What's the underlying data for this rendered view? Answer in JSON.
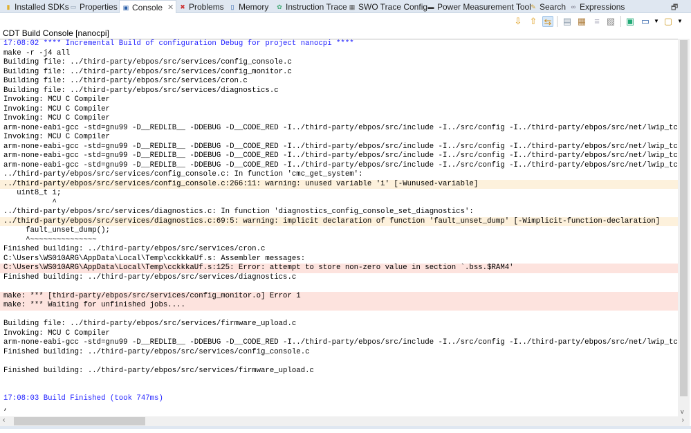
{
  "tabs": [
    {
      "label": "Installed SDKs",
      "icon": "sdk-icon"
    },
    {
      "label": "Properties",
      "icon": "properties-icon"
    },
    {
      "label": "Console",
      "icon": "console-icon",
      "active": true
    },
    {
      "label": "Problems",
      "icon": "problems-icon"
    },
    {
      "label": "Memory",
      "icon": "memory-icon"
    },
    {
      "label": "Instruction Trace",
      "icon": "instruction-trace-icon"
    },
    {
      "label": "SWO Trace Config",
      "icon": "swo-icon"
    },
    {
      "label": "Power Measurement Tool",
      "icon": "power-icon"
    },
    {
      "label": "Search",
      "icon": "search-icon"
    },
    {
      "label": "Expressions",
      "icon": "expressions-icon"
    }
  ],
  "console_title": "CDT Build Console [nanocpi]",
  "colors": {
    "info": "#1f1fff",
    "warning_bg": "#fdf1dc",
    "error_bg": "#fde3de"
  },
  "lines": [
    {
      "t": "17:08:02 **** Incremental Build of configuration Debug for project nanocpi ****",
      "k": "info"
    },
    {
      "t": "make -r -j4 all"
    },
    {
      "t": "Building file: ../third-party/ebpos/src/services/config_console.c"
    },
    {
      "t": "Building file: ../third-party/ebpos/src/services/config_monitor.c"
    },
    {
      "t": "Building file: ../third-party/ebpos/src/services/cron.c"
    },
    {
      "t": "Building file: ../third-party/ebpos/src/services/diagnostics.c"
    },
    {
      "t": "Invoking: MCU C Compiler"
    },
    {
      "t": "Invoking: MCU C Compiler"
    },
    {
      "t": "Invoking: MCU C Compiler"
    },
    {
      "t": "arm-none-eabi-gcc -std=gnu99 -D__REDLIB__ -DDEBUG -D__CODE_RED -I../third-party/ebpos/src/include -I../src/config -I../third-party/ebpos/src/net/lwip_tcpi"
    },
    {
      "t": "Invoking: MCU C Compiler"
    },
    {
      "t": "arm-none-eabi-gcc -std=gnu99 -D__REDLIB__ -DDEBUG -D__CODE_RED -I../third-party/ebpos/src/include -I../src/config -I../third-party/ebpos/src/net/lwip_tcpi"
    },
    {
      "t": "arm-none-eabi-gcc -std=gnu99 -D__REDLIB__ -DDEBUG -D__CODE_RED -I../third-party/ebpos/src/include -I../src/config -I../third-party/ebpos/src/net/lwip_tcpi"
    },
    {
      "t": "arm-none-eabi-gcc -std=gnu99 -D__REDLIB__ -DDEBUG -D__CODE_RED -I../third-party/ebpos/src/include -I../src/config -I../third-party/ebpos/src/net/lwip_tcpi"
    },
    {
      "t": "../third-party/ebpos/src/services/config_console.c: In function 'cmc_get_system':"
    },
    {
      "t": "../third-party/ebpos/src/services/config_console.c:266:11: warning: unused variable 'i' [-Wunused-variable]",
      "k": "warn"
    },
    {
      "t": "   uint8_t i;"
    },
    {
      "t": "           ^"
    },
    {
      "t": "../third-party/ebpos/src/services/diagnostics.c: In function 'diagnostics_config_console_set_diagnostics':"
    },
    {
      "t": "../third-party/ebpos/src/services/diagnostics.c:69:5: warning: implicit declaration of function 'fault_unset_dump' [-Wimplicit-function-declaration]",
      "k": "warn"
    },
    {
      "t": "     fault_unset_dump();"
    },
    {
      "t": "     ^~~~~~~~~~~~~~~~"
    },
    {
      "t": "Finished building: ../third-party/ebpos/src/services/cron.c"
    },
    {
      "t": "C:\\Users\\WS010ARG\\AppData\\Local\\Temp\\cckkkaUf.s: Assembler messages:"
    },
    {
      "t": "C:\\Users\\WS010ARG\\AppData\\Local\\Temp\\cckkkaUf.s:125: Error: attempt to store non-zero value in section `.bss.$RAM4'",
      "k": "err"
    },
    {
      "t": "Finished building: ../third-party/ebpos/src/services/diagnostics.c"
    },
    {
      "t": " "
    },
    {
      "t": "make: *** [third-party/ebpos/src/services/config_monitor.o] Error 1",
      "k": "err"
    },
    {
      "t": "make: *** Waiting for unfinished jobs....",
      "k": "err"
    },
    {
      "t": " "
    },
    {
      "t": "Building file: ../third-party/ebpos/src/services/firmware_upload.c"
    },
    {
      "t": "Invoking: MCU C Compiler"
    },
    {
      "t": "arm-none-eabi-gcc -std=gnu99 -D__REDLIB__ -DDEBUG -D__CODE_RED -I../third-party/ebpos/src/include -I../src/config -I../third-party/ebpos/src/net/lwip_tcpi"
    },
    {
      "t": "Finished building: ../third-party/ebpos/src/services/config_console.c"
    },
    {
      "t": " "
    },
    {
      "t": "Finished building: ../third-party/ebpos/src/services/firmware_upload.c"
    },
    {
      "t": " "
    },
    {
      "t": " "
    },
    {
      "t": "17:08:03 Build Finished (took 747ms)",
      "k": "info"
    },
    {
      "t": ","
    }
  ]
}
